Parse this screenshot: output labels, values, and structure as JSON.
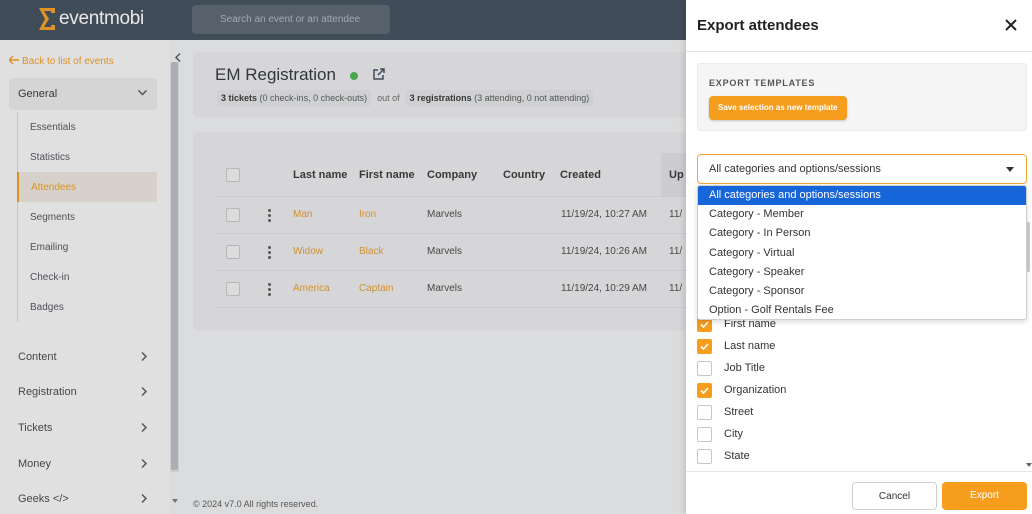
{
  "brand": {
    "name": "eventmobi",
    "accent": "#f79d1e",
    "topbar_color": "#3d4a59",
    "selection_blue": "#1766d9"
  },
  "search": {
    "placeholder": "Search an event or an attendee"
  },
  "sidebar": {
    "back_label": "Back to list of events",
    "general_label": "General",
    "sub_items": [
      {
        "label": "Essentials",
        "active": false
      },
      {
        "label": "Statistics",
        "active": false
      },
      {
        "label": "Attendees",
        "active": true
      },
      {
        "label": "Segments",
        "active": false
      },
      {
        "label": "Emailing",
        "active": false
      },
      {
        "label": "Check-in",
        "active": false
      },
      {
        "label": "Badges",
        "active": false
      }
    ],
    "main_items": [
      {
        "label": "Content"
      },
      {
        "label": "Registration"
      },
      {
        "label": "Tickets"
      },
      {
        "label": "Money"
      },
      {
        "label": "Geeks </>"
      }
    ]
  },
  "event": {
    "title": "EM Registration",
    "tickets_count": "3 tickets",
    "tickets_detail": "(0 check-ins, 0 check-outs)",
    "out_of": "out of",
    "registrations_count": "3 registrations",
    "registrations_detail": "(3 attending, 0 not attending)"
  },
  "table": {
    "headers": [
      "Last name",
      "First name",
      "Company",
      "Country",
      "Created",
      "Up"
    ],
    "rows": [
      {
        "last": "Man",
        "first": "Iron",
        "company": "Marvels",
        "country": "",
        "created": "11/19/24, 10:27 AM",
        "updated": "11/"
      },
      {
        "last": "Widow",
        "first": "Black",
        "company": "Marvels",
        "country": "",
        "created": "11/19/24, 10:26 AM",
        "updated": "11/"
      },
      {
        "last": "America",
        "first": "Captain",
        "company": "Marvels",
        "country": "",
        "created": "11/19/24, 10:29 AM",
        "updated": "11/"
      }
    ]
  },
  "footer": {
    "text": "© 2024 v7.0 All rights reserved."
  },
  "panel": {
    "title": "Export attendees",
    "templates_title": "EXPORT TEMPLATES",
    "save_template_label": "Save selection as new template",
    "select_value": "All categories and options/sessions",
    "dropdown_options": [
      "All categories and options/sessions",
      "Category - Member",
      "Category - In Person",
      "Category - Virtual",
      "Category - Speaker",
      "Category - Sponsor",
      "Option - Golf Rentals Fee"
    ],
    "fields": [
      {
        "label": "First name",
        "checked": true
      },
      {
        "label": "Last name",
        "checked": true
      },
      {
        "label": "Job Title",
        "checked": false
      },
      {
        "label": "Organization",
        "checked": true
      },
      {
        "label": "Street",
        "checked": false
      },
      {
        "label": "City",
        "checked": false
      },
      {
        "label": "State",
        "checked": false
      }
    ],
    "cancel_label": "Cancel",
    "export_label": "Export"
  }
}
